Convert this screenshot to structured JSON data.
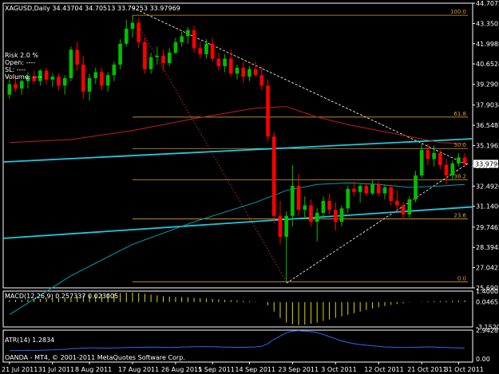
{
  "header": {
    "title": "XAGUSD,Daily  34.43704 34.70513 33.79253 33.97969",
    "info_lines": [
      "Risk   2.0 %",
      "Open: ----",
      "SL: ----",
      "Volume: ----"
    ]
  },
  "indicators": {
    "macd_label": "MACD(12,26,9) 0.257337 0.023005",
    "atr_label": "ATR(14) 1.2834",
    "copyright": "OANDA - MT4, © 2001-2011 MetaQuotes Software Corp."
  },
  "colors": {
    "background": "#000000",
    "up_candle": "#00c000",
    "down_candle": "#ff0000",
    "trendline_cyan": "#20c8e0",
    "ma_red": "#c02020",
    "ma_cyan": "#00a0b0",
    "fib": "#d8a030",
    "macd_hist": "#d8d800",
    "atr_line": "#2a6af0",
    "axis": "#ffffff"
  },
  "chart_data": [
    {
      "type": "candlestick",
      "symbol": "XAGUSD",
      "timeframe": "Daily",
      "ylim": [
        25.6902,
        44.7072
      ],
      "y_ticks": [
        "44.7072",
        "43.3507",
        "41.9988",
        "40.6524",
        "39.2905",
        "37.9034",
        "36.5485",
        "35.1965",
        "33.8446",
        "32.4926",
        "31.1406",
        "29.7462",
        "28.3942",
        "27.0423",
        "25.6902"
      ],
      "current_price_tag": "33.9796",
      "x_ticks": [
        "21 Jul 2011",
        "31 Jul 2011",
        "8 Aug 2011",
        "17 Aug 2011",
        "26 Aug 2011",
        "5 Sep 2011",
        "14 Sep 2011",
        "23 Sep 2011",
        "3 Oct 2011",
        "12 Oct 2011",
        "21 Oct 2011",
        "31 Oct 2011"
      ],
      "fib_levels": [
        "100.0",
        "61.8",
        "50.0",
        "38.2",
        "23.6",
        "0.0"
      ],
      "fib_low": 26.1,
      "fib_high": 43.9,
      "candles": [
        [
          38.6,
          39.6,
          38.3,
          39.3
        ],
        [
          39.3,
          39.9,
          38.8,
          39.0
        ],
        [
          39.0,
          39.6,
          38.6,
          39.5
        ],
        [
          39.5,
          40.1,
          39.0,
          39.8
        ],
        [
          39.8,
          40.2,
          39.3,
          39.5
        ],
        [
          39.5,
          40.3,
          39.2,
          40.2
        ],
        [
          40.2,
          40.4,
          39.3,
          39.6
        ],
        [
          39.6,
          40.0,
          39.1,
          39.8
        ],
        [
          39.8,
          40.0,
          38.9,
          39.2
        ],
        [
          39.2,
          39.9,
          38.6,
          39.7
        ],
        [
          39.7,
          41.8,
          39.5,
          41.6
        ],
        [
          41.6,
          42.1,
          40.2,
          40.6
        ],
        [
          40.6,
          41.2,
          38.3,
          38.8
        ],
        [
          38.8,
          40.0,
          38.2,
          39.7
        ],
        [
          39.7,
          40.4,
          39.3,
          40.1
        ],
        [
          40.1,
          40.4,
          38.9,
          39.2
        ],
        [
          39.2,
          40.1,
          38.8,
          39.9
        ],
        [
          39.9,
          40.8,
          39.5,
          40.6
        ],
        [
          40.6,
          42.3,
          40.3,
          42.0
        ],
        [
          42.0,
          43.6,
          41.8,
          43.0
        ],
        [
          43.0,
          43.9,
          42.4,
          43.4
        ],
        [
          43.4,
          43.7,
          41.7,
          42.1
        ],
        [
          42.1,
          42.4,
          40.0,
          40.3
        ],
        [
          40.3,
          41.4,
          40.0,
          41.1
        ],
        [
          41.1,
          41.8,
          40.6,
          41.2
        ],
        [
          41.2,
          41.6,
          40.2,
          40.7
        ],
        [
          40.7,
          41.7,
          40.5,
          41.4
        ],
        [
          41.4,
          42.4,
          41.3,
          42.1
        ],
        [
          42.1,
          42.8,
          41.8,
          42.5
        ],
        [
          42.5,
          43.1,
          42.0,
          42.9
        ],
        [
          42.9,
          43.2,
          41.4,
          41.7
        ],
        [
          41.7,
          42.1,
          41.0,
          41.3
        ],
        [
          41.3,
          42.3,
          41.0,
          42.0
        ],
        [
          42.0,
          42.4,
          40.8,
          41.0
        ],
        [
          41.0,
          41.4,
          40.2,
          40.5
        ],
        [
          40.5,
          41.3,
          40.1,
          41.0
        ],
        [
          41.0,
          41.6,
          39.8,
          40.0
        ],
        [
          40.0,
          40.6,
          39.6,
          40.4
        ],
        [
          40.4,
          40.8,
          39.4,
          39.8
        ],
        [
          39.8,
          40.5,
          39.5,
          40.3
        ],
        [
          40.3,
          40.8,
          39.8,
          39.9
        ],
        [
          39.9,
          40.5,
          38.9,
          39.2
        ],
        [
          39.2,
          39.6,
          35.5,
          35.8
        ],
        [
          35.8,
          36.1,
          30.0,
          30.5
        ],
        [
          30.5,
          31.5,
          28.6,
          29.1
        ],
        [
          29.1,
          30.8,
          26.1,
          30.5
        ],
        [
          30.5,
          33.9,
          29.8,
          32.5
        ],
        [
          32.5,
          33.3,
          30.5,
          30.9
        ],
        [
          30.9,
          31.8,
          30.3,
          31.2
        ],
        [
          31.2,
          31.6,
          29.8,
          30.1
        ],
        [
          30.1,
          31.0,
          28.8,
          30.7
        ],
        [
          30.7,
          31.8,
          30.3,
          31.5
        ],
        [
          31.5,
          32.0,
          30.6,
          30.9
        ],
        [
          30.9,
          31.4,
          29.5,
          30.1
        ],
        [
          30.1,
          31.2,
          29.8,
          31.0
        ],
        [
          31.0,
          32.5,
          30.7,
          32.3
        ],
        [
          32.3,
          32.8,
          31.8,
          32.1
        ],
        [
          32.1,
          32.6,
          31.4,
          32.5
        ],
        [
          32.5,
          32.7,
          31.8,
          32.0
        ],
        [
          32.0,
          32.9,
          31.9,
          32.6
        ],
        [
          32.6,
          32.8,
          31.8,
          32.0
        ],
        [
          32.0,
          32.6,
          31.6,
          32.4
        ],
        [
          32.4,
          32.6,
          31.2,
          31.5
        ],
        [
          31.5,
          32.2,
          30.8,
          31.2
        ],
        [
          31.2,
          31.4,
          30.3,
          30.6
        ],
        [
          30.6,
          31.8,
          30.4,
          31.6
        ],
        [
          31.6,
          33.5,
          31.4,
          33.2
        ],
        [
          33.2,
          35.3,
          33.0,
          34.9
        ],
        [
          34.9,
          35.3,
          33.9,
          34.3
        ],
        [
          34.3,
          35.2,
          33.8,
          34.7
        ],
        [
          34.7,
          34.9,
          33.6,
          33.9
        ],
        [
          33.9,
          34.3,
          32.6,
          33.2
        ],
        [
          33.2,
          34.2,
          32.9,
          34.0
        ],
        [
          34.0,
          34.7,
          33.8,
          34.4
        ],
        [
          34.4,
          34.7,
          33.8,
          33.98
        ]
      ],
      "ma_red_points": [
        [
          0,
          35.4
        ],
        [
          10,
          35.6
        ],
        [
          20,
          36.2
        ],
        [
          30,
          37.0
        ],
        [
          40,
          37.7
        ],
        [
          45,
          37.8
        ],
        [
          50,
          37.1
        ],
        [
          55,
          36.6
        ],
        [
          60,
          36.2
        ],
        [
          65,
          35.8
        ],
        [
          70,
          35.4
        ],
        [
          74,
          35.3
        ]
      ],
      "ma_cyan_points": [
        [
          0,
          23.9
        ],
        [
          10,
          26.5
        ],
        [
          20,
          28.6
        ],
        [
          30,
          30.1
        ],
        [
          40,
          31.4
        ],
        [
          45,
          32.2
        ],
        [
          50,
          32.6
        ],
        [
          55,
          32.7
        ],
        [
          60,
          32.6
        ],
        [
          65,
          32.4
        ],
        [
          70,
          32.5
        ],
        [
          74,
          32.6
        ]
      ],
      "macd_ylim": [
        -3.15208,
        1.4
      ],
      "macd_ticks": [
        "1.4000",
        "0.0465",
        "-3.15208"
      ],
      "macd_hist": [
        0.25,
        0.28,
        0.3,
        0.33,
        0.35,
        0.4,
        0.42,
        0.45,
        0.48,
        0.5,
        0.62,
        0.75,
        0.85,
        0.9,
        0.95,
        1.0,
        1.05,
        1.1,
        1.15,
        1.2,
        1.22,
        1.15,
        1.05,
        0.95,
        0.85,
        0.75,
        0.7,
        0.65,
        0.62,
        0.6,
        0.55,
        0.5,
        0.45,
        0.4,
        0.35,
        0.3,
        0.25,
        0.2,
        0.15,
        0.1,
        0.05,
        0.0,
        -0.4,
        -1.2,
        -2.0,
        -2.6,
        -2.8,
        -2.9,
        -2.85,
        -2.75,
        -2.6,
        -2.4,
        -2.2,
        -2.0,
        -1.8,
        -1.6,
        -1.4,
        -1.2,
        -1.0,
        -0.8,
        -0.65,
        -0.5,
        -0.35,
        -0.25,
        -0.15,
        -0.05,
        0.0,
        0.05,
        0.1,
        0.12,
        0.14,
        0.16,
        0.18,
        0.2,
        0.22
      ],
      "atr_ylim": [
        0,
        2.9428
      ],
      "atr_ticks": [
        "2.9428",
        "0.00"
      ],
      "atr": [
        1.05,
        1.06,
        1.07,
        1.08,
        1.07,
        1.08,
        1.1,
        1.12,
        1.15,
        1.18,
        1.22,
        1.26,
        1.28,
        1.3,
        1.3,
        1.29,
        1.28,
        1.3,
        1.32,
        1.34,
        1.35,
        1.36,
        1.37,
        1.38,
        1.37,
        1.36,
        1.35,
        1.36,
        1.38,
        1.4,
        1.42,
        1.43,
        1.42,
        1.41,
        1.4,
        1.38,
        1.37,
        1.36,
        1.36,
        1.38,
        1.4,
        1.45,
        1.7,
        2.1,
        2.4,
        2.7,
        2.85,
        2.9,
        2.85,
        2.8,
        2.7,
        2.55,
        2.35,
        2.15,
        1.95,
        1.8,
        1.7,
        1.6,
        1.55,
        1.5,
        1.45,
        1.4,
        1.38,
        1.36,
        1.35,
        1.34,
        1.36,
        1.38,
        1.4,
        1.38,
        1.36,
        1.34,
        1.32,
        1.3,
        1.28
      ]
    }
  ]
}
